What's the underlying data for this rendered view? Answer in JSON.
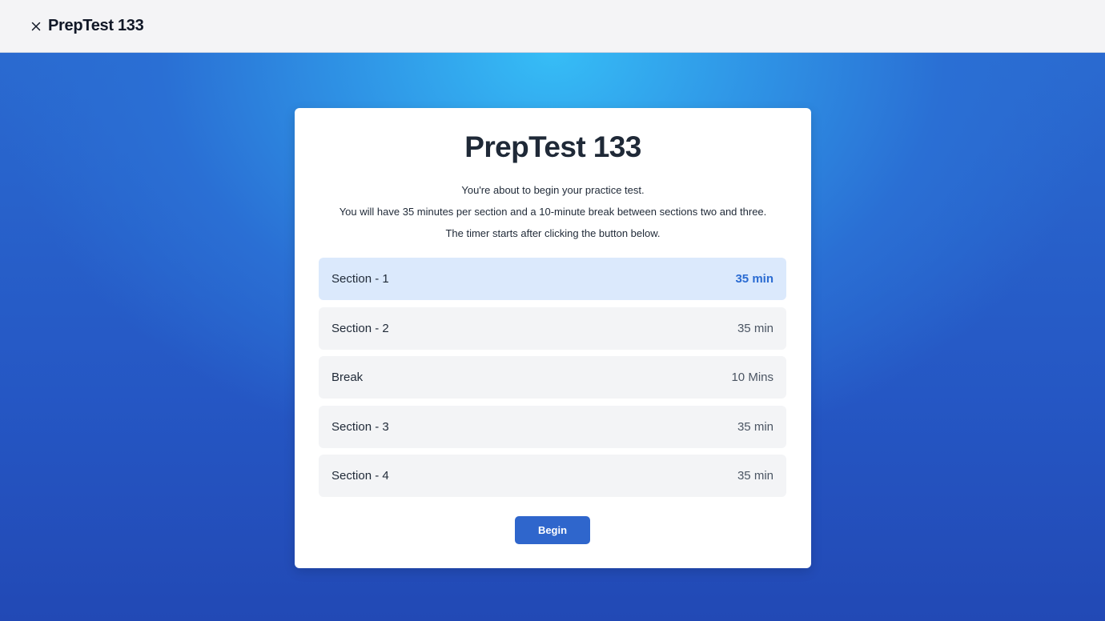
{
  "header": {
    "close_icon": "close-icon",
    "title": "PrepTest 133"
  },
  "card": {
    "title": "PrepTest 133",
    "description": [
      "You're about to begin your practice test.",
      "You will have 35 minutes per section and a 10-minute break between sections two and three.",
      "The timer starts after clicking the button below."
    ],
    "sections": [
      {
        "label": "Section - 1",
        "time": "35 min",
        "active": true
      },
      {
        "label": "Section - 2",
        "time": "35 min",
        "active": false
      },
      {
        "label": "Break",
        "time": "10 Mins",
        "active": false
      },
      {
        "label": "Section - 3",
        "time": "35 min",
        "active": false
      },
      {
        "label": "Section - 4",
        "time": "35 min",
        "active": false
      }
    ],
    "begin_label": "Begin"
  },
  "colors": {
    "accent": "#2f66cc",
    "active_row_bg": "#dbe9fc",
    "active_time": "#2a6bd2"
  }
}
